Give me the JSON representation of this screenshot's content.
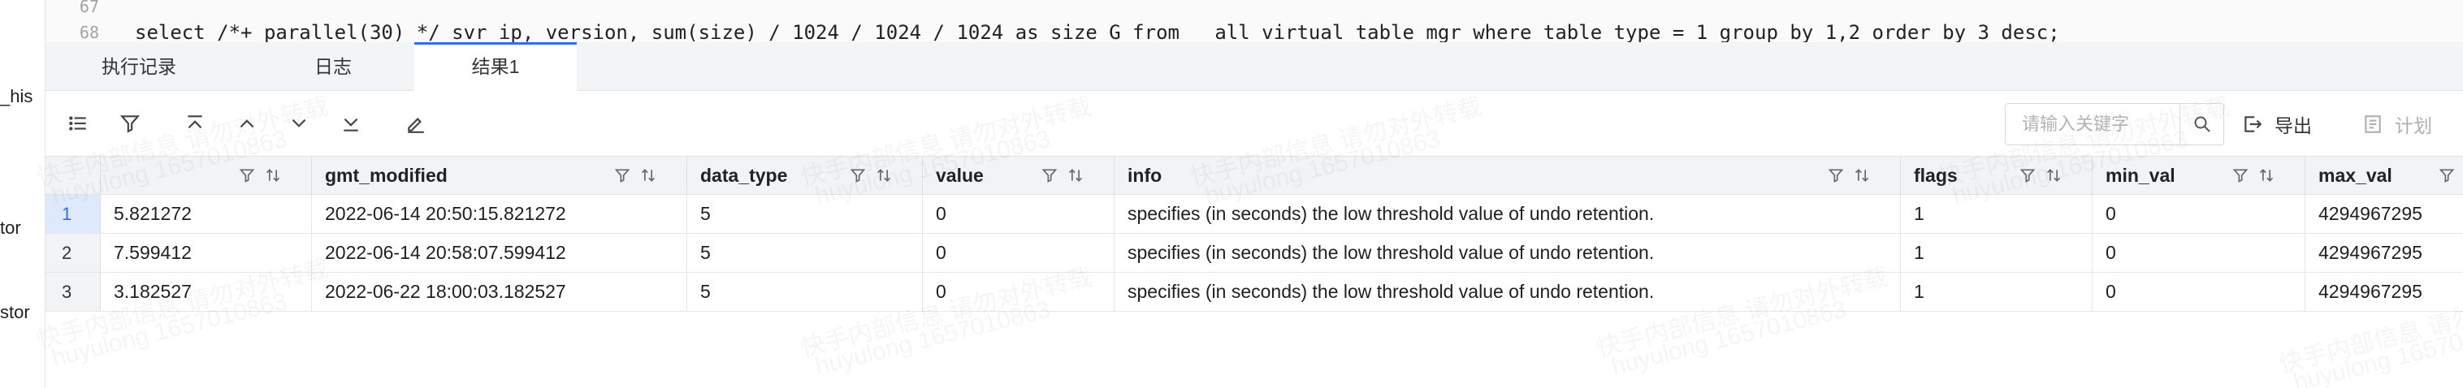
{
  "left_tree": {
    "items": [
      "_his",
      "tor",
      "stor"
    ]
  },
  "editor": {
    "lines": [
      {
        "no": "67",
        "code": ""
      },
      {
        "no": "68",
        "code": "select /*+ parallel(30) */ svr_ip, version, sum(size) / 1024 / 1024 / 1024 as size_G from __all_virtual_table_mgr where table_type = 1 group by 1,2 order by 3 desc;"
      }
    ]
  },
  "tabs": [
    {
      "label": "执行记录",
      "active": false
    },
    {
      "label": "日志",
      "active": false
    },
    {
      "label": "结果1",
      "active": true
    }
  ],
  "toolbar": {
    "search_placeholder": "请输入关键字",
    "export_label": "导出",
    "plan_label": "计划"
  },
  "grid": {
    "columns": [
      "",
      "gmt_modified",
      "data_type",
      "value",
      "info",
      "flags",
      "min_val",
      "max_val"
    ],
    "rows": [
      {
        "num": "1",
        "cells": [
          "5.821272",
          "2022-06-14 20:50:15.821272",
          "5",
          "0",
          "specifies (in seconds) the low threshold value of undo retention.",
          "1",
          "0",
          "4294967295"
        ]
      },
      {
        "num": "2",
        "cells": [
          "7.599412",
          "2022-06-14 20:58:07.599412",
          "5",
          "0",
          "specifies (in seconds) the low threshold value of undo retention.",
          "1",
          "0",
          "4294967295"
        ]
      },
      {
        "num": "3",
        "cells": [
          "3.182527",
          "2022-06-22 18:00:03.182527",
          "5",
          "0",
          "specifies (in seconds) the low threshold value of undo retention.",
          "1",
          "0",
          "4294967295"
        ]
      }
    ]
  },
  "watermark": {
    "line1": "快手内部信息 请勿对外转载",
    "line2": "huyulong 1657010863"
  },
  "colors": {
    "accent": "#2f6cf6",
    "header_bg": "#f2f3f5"
  }
}
